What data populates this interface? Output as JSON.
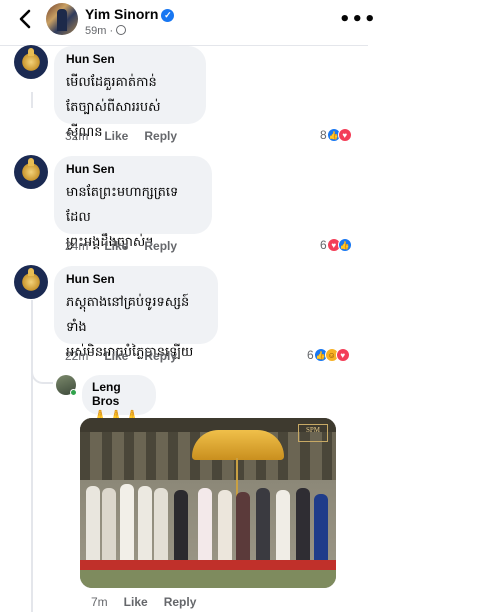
{
  "header": {
    "name": "Yim Sinorn",
    "time": "59m ·"
  },
  "comments": [
    {
      "author": "Hun Sen",
      "line1": "មើលដែគួរគាត់កាន់",
      "line2": "តែច្បាស់ពីសាររបស់ស៊ីណន",
      "time": "32m",
      "like": "Like",
      "reply": "Reply",
      "reaction_count": "8"
    },
    {
      "author": "Hun Sen",
      "line1": "មានតែព្រះមហាក្សត្រទេដែល",
      "line2": "ព្រះអង្គដឹងច្បាស់។",
      "time": "24m",
      "like": "Like",
      "reply": "Reply",
      "reaction_count": "6"
    },
    {
      "author": "Hun Sen",
      "line1": "ភស្តុតាងនៅគ្រប់ទូរទស្សន៍ទាំង",
      "line2": "អស់មិនអាចបំភ្លៃបានឡើយ",
      "time": "22m",
      "like": "Like",
      "reply": "Reply",
      "reaction_count": "6"
    }
  ],
  "reply": {
    "author": "Leng Bros",
    "text": "🙏🙏🙏",
    "time": "7m",
    "like": "Like",
    "reply": "Reply",
    "photo_watermark": "SPM"
  },
  "icons": {
    "back": "back-arrow-icon",
    "more": "more-options-icon",
    "verified": "verified-badge-icon",
    "globe": "public-globe-icon",
    "like": "like-reaction-icon",
    "love": "love-reaction-icon",
    "care": "care-reaction-icon"
  },
  "colors": {
    "accent": "#1877f2",
    "bubble": "#f0f2f5",
    "meta_text": "#65676b",
    "love": "#f33e58"
  }
}
